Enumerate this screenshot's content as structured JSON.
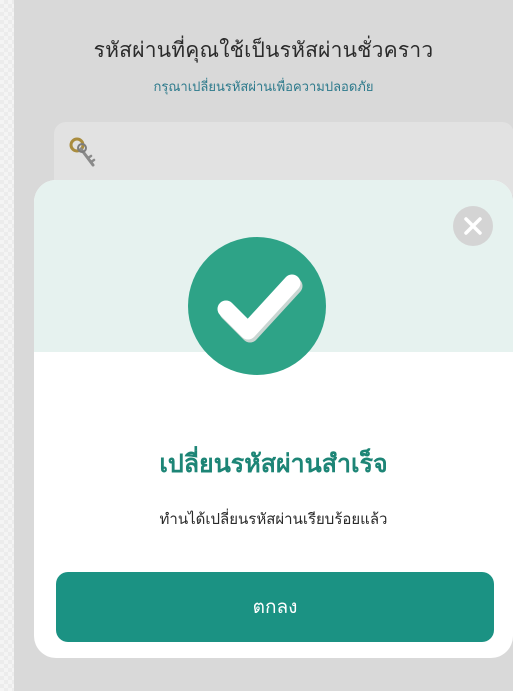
{
  "page": {
    "title": "รหัสผ่านที่คุณใช้เป็นรหัสผ่านชั่วคราว",
    "subtitle": "กรุณาเปลี่ยนรหัสผ่านเพื่อความปลอดภัย"
  },
  "password_field": {
    "icon": "key-icon"
  },
  "modal": {
    "close_icon": "close-icon",
    "status_icon": "checkmark-icon",
    "title": "เปลี่ยนรหัสผ่านสำเร็จ",
    "message": "ทำนได้เปลี่ยนรหัสผ่านเรียบร้อยแล้ว",
    "ok_label": "ตกลง"
  },
  "colors": {
    "accent": "#1b9283",
    "title": "#1d8576",
    "success_circle": "#2ea387",
    "header_band": "#e6f2ef"
  }
}
